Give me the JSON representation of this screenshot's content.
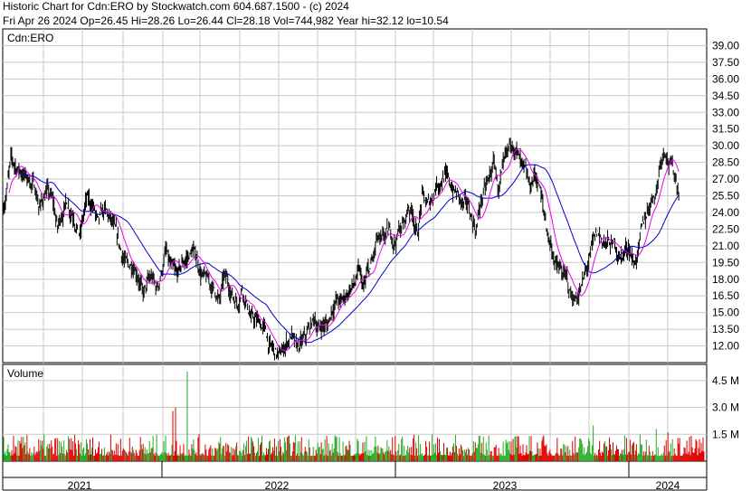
{
  "header": {
    "line1": "Historic Chart for Cdn:ERO by Stockwatch.com 604.687.1500 - (c) 2024",
    "line2": "Fri Apr 26 2024   Op=26.45   Hi=28.26   Lo=26.44   Cl=28.18   Vol=744,982   Year hi=32.12   lo=10.54"
  },
  "chart_data": [
    {
      "type": "line",
      "title": "Cdn:ERO",
      "y_ticks": [
        "39.00",
        "37.50",
        "36.00",
        "34.50",
        "33.00",
        "31.50",
        "30.00",
        "28.50",
        "27.00",
        "25.50",
        "24.00",
        "22.50",
        "21.00",
        "19.50",
        "18.00",
        "16.50",
        "15.00",
        "13.50",
        "12.00"
      ],
      "ylim": [
        10.5,
        40.5
      ],
      "x_ticks": [
        "2021",
        "2022",
        "2023",
        "2024"
      ],
      "grid": true,
      "colors": {
        "price": "#000000",
        "ma_short": "#ee00ee",
        "ma_long": "#0000cc",
        "vol_up": "#22aa22",
        "vol_down": "#dd0000",
        "grid": "#c8c8c8"
      },
      "price_anchors": {
        "t": [
          0,
          8,
          15,
          22,
          28,
          35,
          40,
          48,
          55,
          60,
          65,
          70,
          78,
          85,
          92,
          100,
          105,
          112,
          120,
          130,
          138,
          145,
          150,
          155,
          160,
          165,
          170,
          175,
          180,
          185,
          192,
          200,
          205,
          210,
          215,
          220,
          225,
          230,
          235,
          240,
          245,
          250,
          255,
          260,
          265,
          270,
          275,
          280,
          285,
          290,
          295,
          300,
          303,
          306,
          310,
          315,
          320,
          325,
          330,
          335,
          340,
          345,
          350,
          355,
          360,
          365,
          370,
          375,
          380,
          385,
          390,
          395,
          400,
          405,
          410,
          415,
          420,
          425,
          430,
          435,
          440,
          445,
          450,
          455,
          460,
          465,
          470,
          475,
          480,
          485,
          490,
          495,
          500,
          505,
          510,
          515,
          520,
          525,
          530,
          535,
          540,
          545,
          550,
          555,
          560,
          565,
          570,
          575,
          580,
          585,
          590,
          595,
          600,
          605,
          610,
          615,
          620,
          625,
          630,
          635,
          640,
          645,
          650,
          655,
          660,
          665,
          670,
          675,
          680,
          685,
          690,
          695,
          700,
          705,
          710,
          715,
          720,
          725,
          730,
          735,
          740,
          745,
          750,
          755,
          760,
          765,
          770,
          775,
          778
        ],
        "close": [
          24.5,
          28.5,
          28.0,
          27.5,
          27.0,
          26.2,
          24.5,
          26.0,
          24.8,
          22.5,
          24.0,
          25.0,
          24.0,
          22.0,
          25.0,
          24.5,
          22.8,
          24.0,
          23.0,
          20.5,
          19.0,
          19.5,
          18.5,
          16.5,
          17.5,
          18.0,
          17.0,
          18.5,
          20.5,
          19.0,
          18.0,
          19.5,
          20.0,
          20.5,
          19.8,
          18.5,
          17.8,
          17.5,
          17.0,
          16.0,
          18.0,
          17.5,
          16.5,
          16.0,
          17.5,
          16.0,
          14.5,
          14.2,
          14.0,
          13.5,
          12.0,
          11.5,
          11.2,
          11.0,
          11.5,
          12.5,
          13.0,
          11.5,
          12.0,
          12.5,
          13.5,
          14.5,
          13.5,
          14.0,
          13.8,
          15.5,
          16.2,
          15.8,
          16.5,
          17.2,
          17.5,
          18.5,
          17.0,
          18.5,
          19.5,
          21.5,
          21.0,
          21.8,
          22.0,
          21.5,
          22.5,
          23.0,
          24.5,
          24.0,
          22.0,
          25.5,
          24.5,
          25.0,
          26.5,
          27.0,
          27.5,
          26.5,
          26.0,
          25.5,
          24.5,
          24.5,
          23.5,
          22.5,
          25.0,
          26.0,
          27.0,
          28.5,
          26.0,
          27.5,
          29.0,
          30.5,
          29.5,
          28.0,
          27.0,
          26.0,
          27.5,
          26.5,
          24.0,
          22.0,
          20.5,
          19.0,
          18.5,
          18.0,
          16.5,
          16.2,
          17.0,
          18.0,
          19.5,
          21.0,
          22.0,
          21.5,
          21.2,
          21.0,
          21.0,
          20.0,
          20.5,
          21.0,
          19.5,
          20.5,
          22.5,
          24.0,
          25.5,
          26.0,
          29.0,
          30.0,
          28.5,
          27.5,
          26.0
        ]
      },
      "ma_short_period": 15,
      "ma_long_period": 50
    },
    {
      "type": "bar",
      "title": "Volume",
      "y_ticks": [
        "4.5 M",
        "3.0 M",
        "1.5 M"
      ],
      "ylim": [
        0,
        5.4
      ],
      "unit": "million shares",
      "typical_range": [
        0.3,
        1.5
      ],
      "spikes": [
        {
          "t": 188,
          "value": 2.8
        },
        {
          "t": 191,
          "value": 3.0
        },
        {
          "t": 204,
          "value": 5.0
        },
        {
          "t": 655,
          "value": 2.0
        },
        {
          "t": 725,
          "value": 1.8
        },
        {
          "t": 738,
          "value": 1.6
        }
      ]
    }
  ]
}
